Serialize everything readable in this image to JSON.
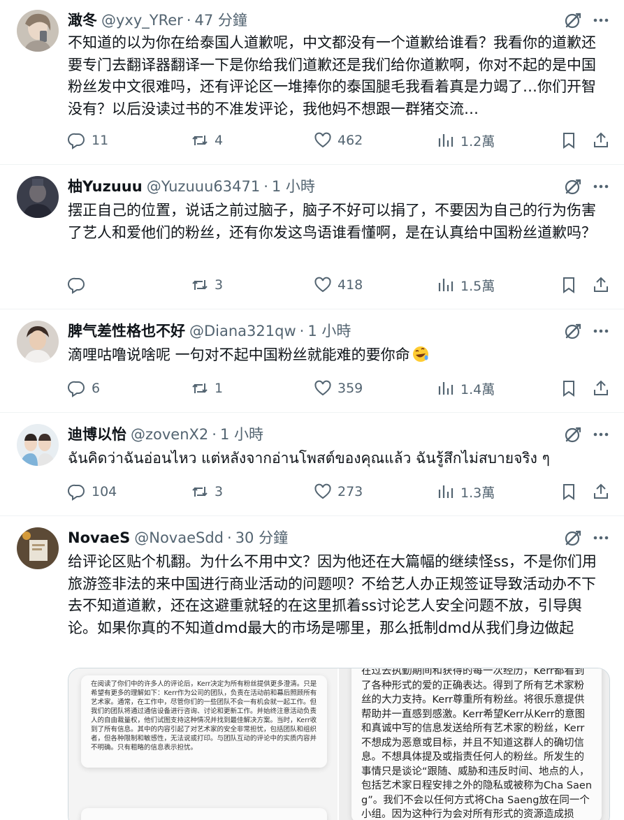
{
  "tweets": [
    {
      "name": "澉冬",
      "handle": "@yxy_YRer",
      "time": "47 分鐘",
      "text": "不知道的以为你在给泰国人道歉呢，中文都没有一个道歉给谁看？我看你的道歉还要专门去翻译器翻译一下是你给我们道歉还是我们给你道歉啊，你对不起的是中国粉丝发中文很难吗，还有评论区一堆捧你的泰国腿毛我看着真是力竭了…你们开智没有？以后没读过书的不准发评论，我他妈不想跟一群猪交流…",
      "replies": "11",
      "reposts": "4",
      "likes": "462",
      "views": "1.2萬"
    },
    {
      "name": "柚Yuzuuu",
      "handle": "@Yuzuuu63471",
      "time": "1 小時",
      "text": "摆正自己的位置，说话之前过脑子，脑子不好可以捐了，不要因为自己的行为伤害了艺人和爱他们的粉丝，还有你发这鸟语谁看懂啊，是在认真给中国粉丝道歉吗？",
      "replies": "",
      "reposts": "3",
      "likes": "418",
      "views": "1.5萬"
    },
    {
      "name": "脾气差性格也不好",
      "handle": "@Diana321qw",
      "time": "1 小時",
      "text": "滴哩咕噜说啥呢 一句对不起中国粉丝就能难的要你命",
      "replies": "6",
      "reposts": "1",
      "likes": "359",
      "views": "1.4萬"
    },
    {
      "name": "迪博以怡",
      "handle": "@zovenX2",
      "time": "1 小時",
      "text": "ฉันคิดว่าฉันอ่อนไหว แต่หลังจากอ่านโพสต์ของคุณแล้ว ฉันรู้สึกไม่สบายจริง ๆ",
      "replies": "104",
      "reposts": "3",
      "likes": "273",
      "views": "1.3萬"
    },
    {
      "name": "NovaeS",
      "handle": "@NovaeSdd",
      "time": "30 分鐘",
      "text": "给评论区贴个机翻。为什么不用中文？因为他还在大篇幅的继续怪ss，不是你们用旅游签非法的来中国进行商业活动的问题呗？不给艺人办正规签证导致活动办不下去不知道道歉，还在这避重就轻的在这里抓着ss讨论艺人安全问题不放，引导舆论。如果你真的不知道dmd最大的市场是哪里，那么抵制dmd从我们身边做起",
      "media_left_text": "在阅读了你们中的许多人的评论后，Kerr决定为所有粉丝提供更多澄清。只是希望有更多的理解如下：Kerr作为公司的团队，负责在活动前和幕后照顾所有艺术家。通常，在工作中，尽管你们的一些团队不会一有机会就一起工作。但我们的团队将通过通信设备进行咨询、讨论和更新工作。并始终注意活动负责人的自由裁量权，他们试图支持这种情况并找到最佳解决方案。当时，Kerr收到了所有信息。其中的内容引起了对艺术家的安全非常担忧，包括团队和组织者，但各种限制和敏感性，无法说或打印。与团队互动的评论中的实质内容并不明确。只有粗略的信息表示担忧。",
      "media_right_text": "在过去执勤期间和获得的每一次经历，Kerr都看到了各种形式的爱的正确表达。得到了所有艺术家粉丝的大力支持。Kerr尊重所有粉丝。将很乐意提供帮助并一直感到感激。Kerr希望Kerr从Kerr的意图和真诚中写的信息发送给所有艺术家的粉丝，Kerr不想成为恶意或目标，并且不知道这群人的确切信息。不想具体提及或指责任何人的粉丝。所发生的事情只是谈论“跟随、威胁和违反时间、地点的人，包括艺术家日程安排之外的隐私或被称为Cha Saeng”。我们不会以任何方式将Cha Saeng放在同一个小组。因为这种行为会对所有形式的资源造成损害。无论是艺术家、遵"
    }
  ],
  "icons": {
    "grok": "grok-icon",
    "more": "more-icon",
    "reply": "reply-icon",
    "repost": "repost-icon",
    "like": "heart-icon",
    "views": "views-icon",
    "bookmark": "bookmark-icon",
    "share": "share-icon",
    "emoji": "rolling-laughing-emoji"
  },
  "colors": {
    "text": "#0f1419",
    "secondary": "#536471",
    "divider": "#eff3f4"
  }
}
